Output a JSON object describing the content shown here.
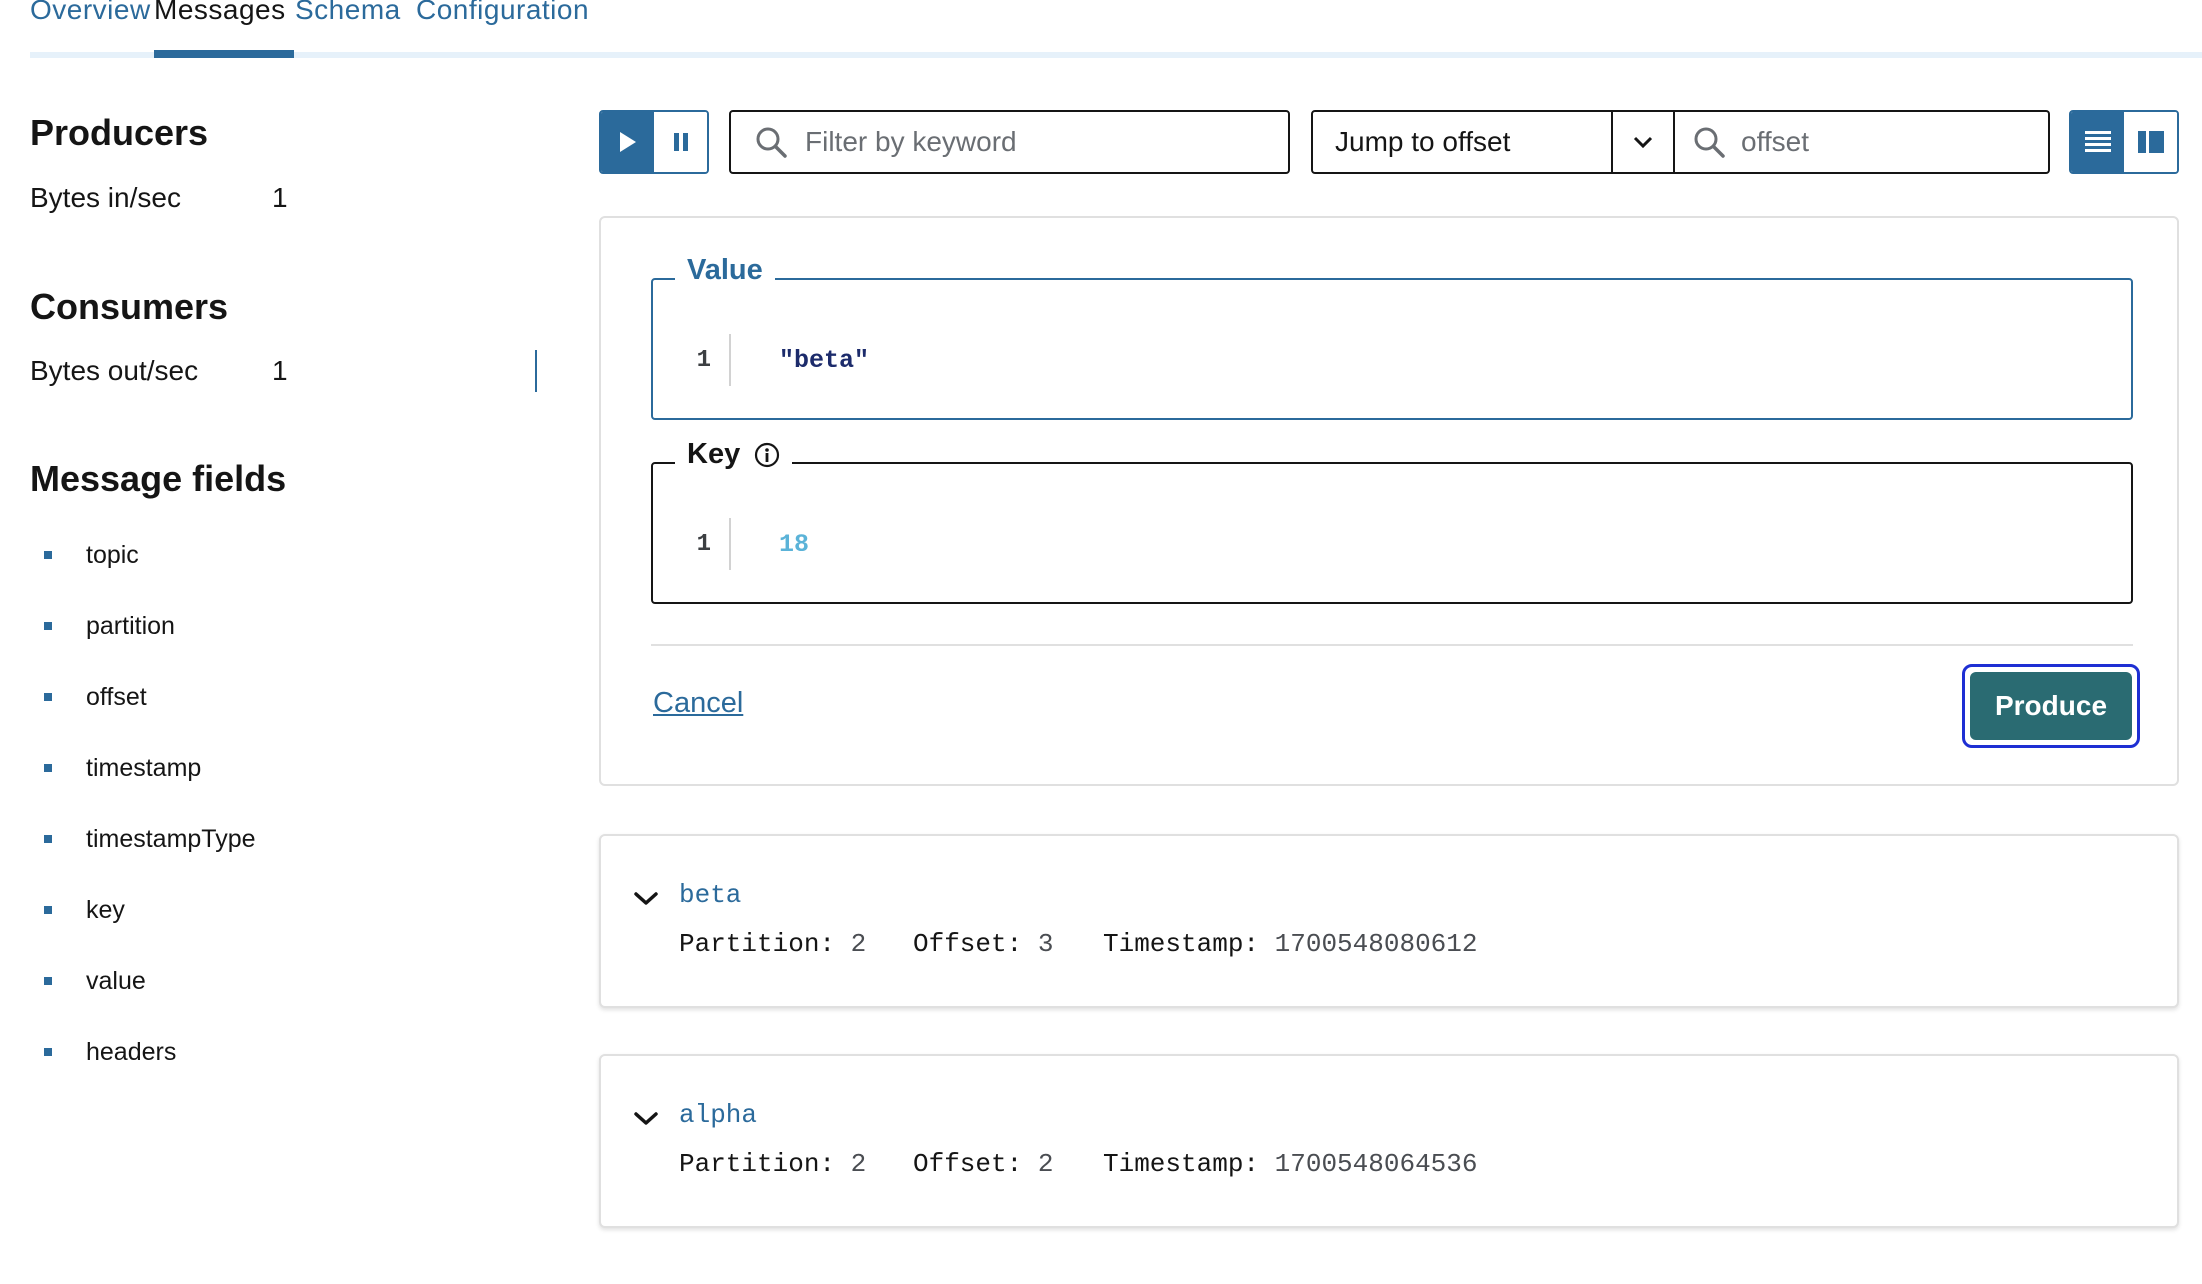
{
  "tabs": [
    {
      "label": "Overview"
    },
    {
      "label": "Messages"
    },
    {
      "label": "Schema"
    },
    {
      "label": "Configuration"
    }
  ],
  "sidebar": {
    "producers": {
      "title": "Producers",
      "metric_label": "Bytes in/sec",
      "metric_value": "1"
    },
    "consumers": {
      "title": "Consumers",
      "metric_label": "Bytes out/sec",
      "metric_value": "1"
    },
    "message_fields": {
      "title": "Message fields",
      "items": [
        "topic",
        "partition",
        "offset",
        "timestamp",
        "timestampType",
        "key",
        "value",
        "headers"
      ]
    }
  },
  "toolbar": {
    "filter_placeholder": "Filter by keyword",
    "jump_select_value": "Jump to offset",
    "offset_placeholder": "offset",
    "play_icon": "play-icon",
    "pause_icon": "pause-icon"
  },
  "produce": {
    "value_legend": "Value",
    "value_line_number": "1",
    "value_code": "\"beta\"",
    "key_legend": "Key",
    "key_line_number": "1",
    "key_code": "18",
    "cancel_label": "Cancel",
    "produce_label": "Produce"
  },
  "messages": [
    {
      "key": "beta",
      "partition_label": "Partition:",
      "partition": "2",
      "offset_label": "Offset:",
      "offset": "3",
      "timestamp_label": "Timestamp:",
      "timestamp": "1700548080612"
    },
    {
      "key": "alpha",
      "partition_label": "Partition:",
      "partition": "2",
      "offset_label": "Offset:",
      "offset": "2",
      "timestamp_label": "Timestamp:",
      "timestamp": "1700548064536"
    }
  ],
  "colors": {
    "accent": "#2b6a9b",
    "produce_button": "#2a6b72",
    "focus_ring": "#1e2fd3",
    "key_code": "#5bb3d8",
    "value_code": "#1c2b6b"
  }
}
